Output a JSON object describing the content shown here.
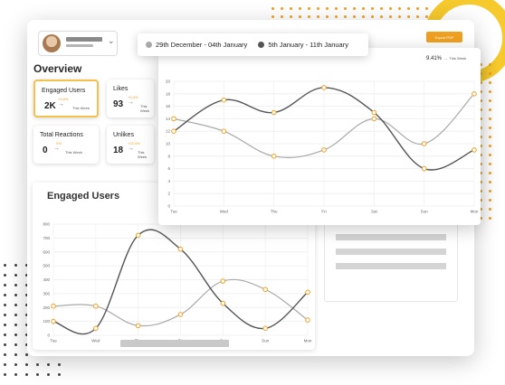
{
  "colors": {
    "accent": "#f0a020",
    "series_a": "#a9a9a9",
    "series_b": "#555555",
    "yellow": "#f6c92c"
  },
  "header": {
    "export_label": "Export PDF",
    "user_select": {
      "icon": "chevron-down-icon"
    }
  },
  "overview": {
    "title": "Overview",
    "stats": [
      {
        "label": "Engaged Users",
        "value": "2K",
        "change": "+4,5%",
        "period": "This Week",
        "active": true
      },
      {
        "label": "Likes",
        "value": "93",
        "change": "+9,4%",
        "period": "This Week",
        "active": false
      },
      {
        "label": "Total Reactions",
        "value": "0",
        "change": "0%",
        "period": "This Week",
        "active": false
      },
      {
        "label": "Unlikes",
        "value": "18",
        "change": "+22,4%",
        "period": "This Week",
        "active": false
      }
    ]
  },
  "engaged": {
    "title": "Engaged Users"
  },
  "overlay": {
    "stat_value": "9.41%",
    "stat_note": "This Week",
    "legend": [
      {
        "label": "29th December - 04th January",
        "color": "#a9a9a9"
      },
      {
        "label": "5th January - 11th January",
        "color": "#555555"
      }
    ]
  },
  "chart_data": [
    {
      "type": "line",
      "categories": [
        "Tue",
        "Wed",
        "Thu",
        "Fri",
        "Sat",
        "Sun",
        "Mon"
      ],
      "ylim": [
        0,
        800
      ],
      "yticks": [
        0,
        100,
        200,
        300,
        400,
        500,
        600,
        700,
        800
      ],
      "grid": true,
      "series": [
        {
          "values": [
            210,
            210,
            70,
            150,
            390,
            330,
            110
          ]
        },
        {
          "values": [
            100,
            50,
            720,
            620,
            230,
            50,
            310
          ]
        }
      ]
    },
    {
      "type": "line",
      "categories": [
        "Tue",
        "Wed",
        "Thu",
        "Fri",
        "Sat",
        "Sun",
        "Mon"
      ],
      "ylim": [
        0,
        20
      ],
      "yticks": [
        0,
        2,
        4,
        6,
        8,
        10,
        12,
        14,
        16,
        18,
        20
      ],
      "grid": true,
      "series": [
        {
          "values": [
            14,
            12,
            8,
            9,
            14,
            10,
            18
          ]
        },
        {
          "values": [
            12,
            17,
            15,
            19,
            15,
            6,
            9
          ]
        }
      ]
    }
  ]
}
